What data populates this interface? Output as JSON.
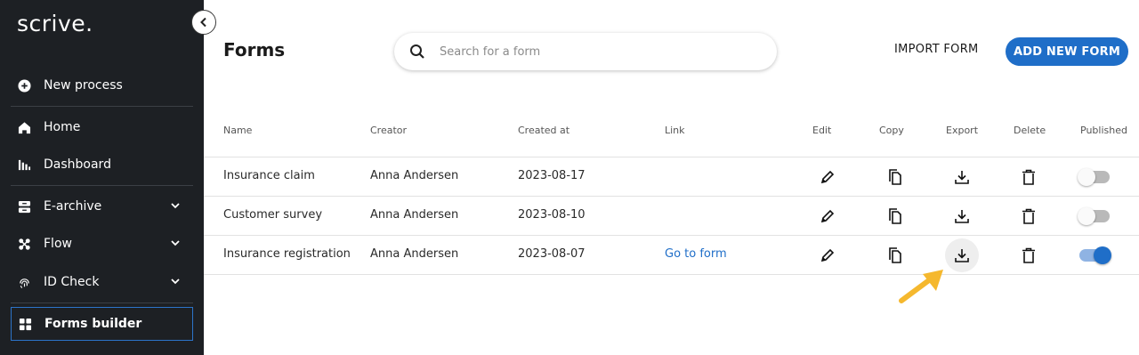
{
  "app": {
    "logo": "scrive.",
    "collapse_icon": "chevron-left-icon"
  },
  "sidebar": {
    "items": [
      {
        "label": "New process",
        "icon": "plus-circle-icon"
      },
      {
        "label": "Home",
        "icon": "home-icon"
      },
      {
        "label": "Dashboard",
        "icon": "bar-chart-icon"
      },
      {
        "label": "E-archive",
        "icon": "archive-icon",
        "expandable": true
      },
      {
        "label": "Flow",
        "icon": "flow-icon",
        "expandable": true
      },
      {
        "label": "ID Check",
        "icon": "fingerprint-icon",
        "expandable": true
      },
      {
        "label": "Forms builder",
        "icon": "grid-icon",
        "active": true
      }
    ]
  },
  "header": {
    "title": "Forms",
    "search_placeholder": "Search for a form",
    "import_label": "IMPORT FORM",
    "add_label": "ADD NEW FORM"
  },
  "table": {
    "columns": [
      "Name",
      "Creator",
      "Created at",
      "Link",
      "Edit",
      "Copy",
      "Export",
      "Delete",
      "Published"
    ],
    "rows": [
      {
        "name": "Insurance claim",
        "creator": "Anna Andersen",
        "created": "2023-08-17",
        "link": "",
        "published": false
      },
      {
        "name": "Customer survey",
        "creator": "Anna Andersen",
        "created": "2023-08-10",
        "link": "",
        "published": false
      },
      {
        "name": "Insurance registration",
        "creator": "Anna Andersen",
        "created": "2023-08-07",
        "link": "Go to form",
        "published": true
      }
    ]
  },
  "colors": {
    "sidebar_bg": "#1d2024",
    "accent": "#1f6ec8",
    "arrow": "#f5b82e"
  }
}
